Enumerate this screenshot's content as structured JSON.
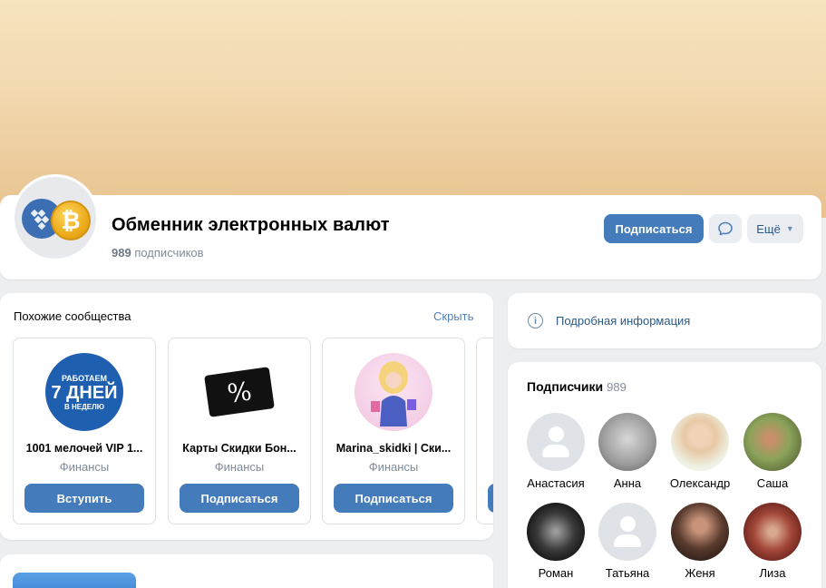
{
  "community": {
    "title": "Обменник электронных валют",
    "subscriber_count": "989",
    "subscriber_label": "подписчиков",
    "btc_symbol": "₿"
  },
  "actions": {
    "subscribe_label": "Подписаться",
    "more_label": "Ещё"
  },
  "similar": {
    "title": "Похожие сообщества",
    "hide_label": "Скрыть",
    "groups": [
      {
        "name": "1001 мелочей VIP 1...",
        "category": "Финансы",
        "button": "Вступить",
        "avatar_lines": [
          "РАБОТАЕМ",
          "7 ДНЕЙ",
          "В НЕДЕЛЮ"
        ]
      },
      {
        "name": "Карты Скидки Бон...",
        "category": "Финансы",
        "button": "Подписаться",
        "avatar_text": "%"
      },
      {
        "name": "Marina_skidki | Ски...",
        "category": "Финансы",
        "button": "Подписаться"
      }
    ]
  },
  "info": {
    "label": "Подробная информация",
    "icon_glyph": "i"
  },
  "members": {
    "title": "Подписчики",
    "count": "989",
    "list": [
      {
        "name": "Анастасия",
        "avatar": "default"
      },
      {
        "name": "Анна",
        "avatar": "photo",
        "color": "#9a9a9a"
      },
      {
        "name": "Олександр",
        "avatar": "photo",
        "color": "#d9b58f"
      },
      {
        "name": "Саша",
        "avatar": "photo",
        "color": "#7b8a4a"
      },
      {
        "name": "Роман",
        "avatar": "photo",
        "color": "#2b2b2b"
      },
      {
        "name": "Татьяна",
        "avatar": "default"
      },
      {
        "name": "Женя",
        "avatar": "photo",
        "color": "#5a3b2e"
      },
      {
        "name": "Лиза",
        "avatar": "photo",
        "color": "#8a2f26"
      }
    ]
  },
  "colors": {
    "accent": "#447bba",
    "link": "#2a5885",
    "cover": "#f1d8ad",
    "page_bg": "#edeef0"
  }
}
